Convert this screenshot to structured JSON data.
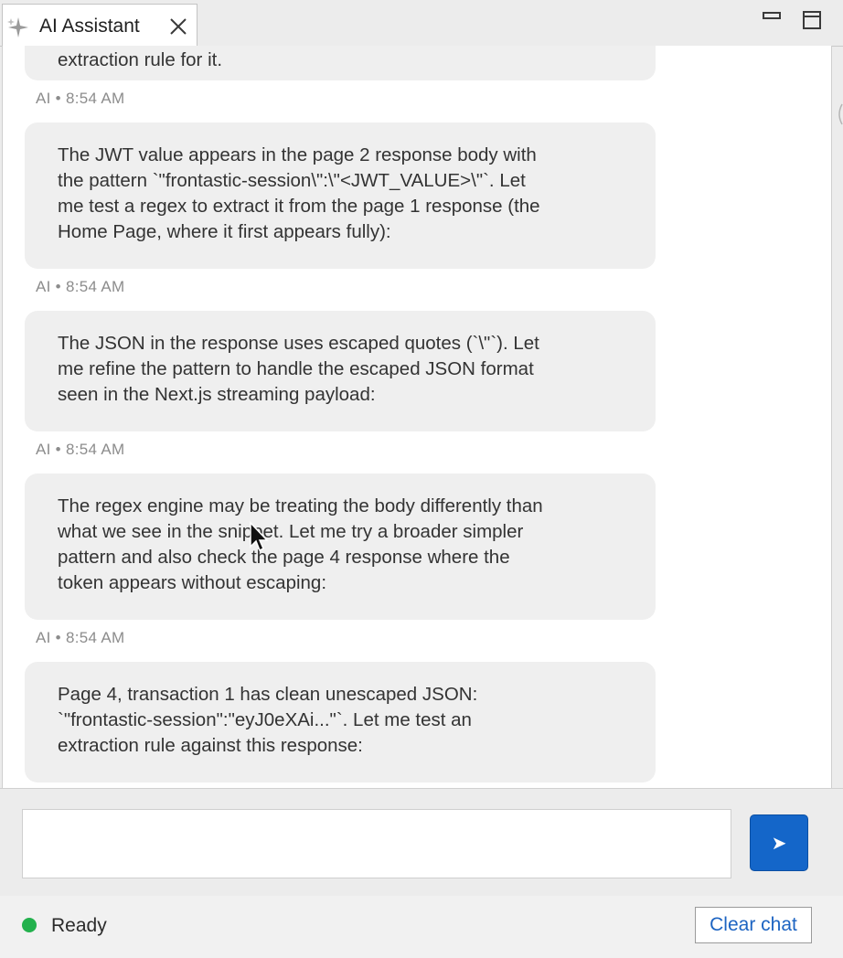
{
  "tab": {
    "title": "AI Assistant",
    "icon": "sparkle-icon",
    "close_icon": "close-icon"
  },
  "view_buttons": [
    "minimize-icon",
    "maximize-icon"
  ],
  "messages": [
    {
      "lines": [
        "extraction rule for it."
      ],
      "meta": "AI • 8:54 AM"
    },
    {
      "lines": [
        "The JWT value appears in the page 2 response body with",
        "the pattern `\"frontastic-session\\\":\\\"<JWT_VALUE>\\\"`. Let",
        "me test a regex to extract it from the page 1 response (the",
        "Home Page, where it first appears fully):"
      ],
      "meta": "AI • 8:54 AM"
    },
    {
      "lines": [
        "The JSON in the response uses escaped quotes (`\\\"`). Let",
        "me refine the pattern to handle the escaped JSON format",
        "seen in the Next.js streaming payload:"
      ],
      "meta": "AI • 8:54 AM"
    },
    {
      "lines": [
        "The regex engine may be treating the body differently than",
        "what we see in the snippet. Let me try a broader simpler",
        "pattern and also check the page 4 response where the",
        "token appears without escaping:"
      ],
      "meta": "AI • 8:54 AM"
    },
    {
      "lines": [
        "Page 4, transaction 1 has clean unescaped JSON:",
        "`\"frontastic-session\":\"eyJ0eXAi...\"`. Let me test an",
        "extraction rule against this response:"
      ]
    }
  ],
  "input": {
    "value": "",
    "placeholder": ""
  },
  "send_button": {
    "label": "➤",
    "icon": "send-arrow-icon",
    "color": "#1466c9"
  },
  "status": {
    "text": "Ready",
    "color": "#23b14d"
  },
  "clear_button": {
    "label": "Clear chat",
    "color": "#1d64c2"
  }
}
